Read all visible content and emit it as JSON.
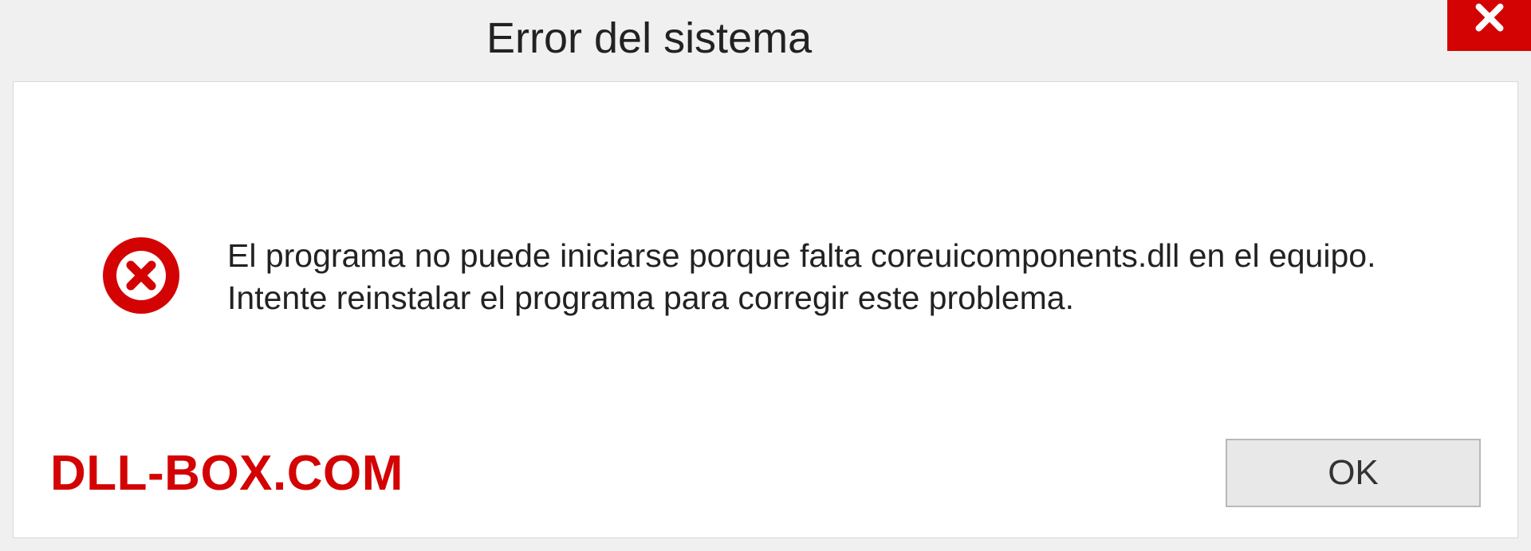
{
  "dialog": {
    "title": "Error del sistema",
    "message": "El programa no puede iniciarse porque falta coreuicomponents.dll en el equipo. Intente reinstalar el programa para corregir este problema.",
    "ok_label": "OK",
    "watermark": "DLL-BOX.COM",
    "colors": {
      "accent_red": "#d40303",
      "panel_bg": "#ffffff",
      "frame_bg": "#f0f0f0"
    },
    "icons": {
      "close": "close-icon",
      "error": "error-circle-x-icon"
    }
  }
}
